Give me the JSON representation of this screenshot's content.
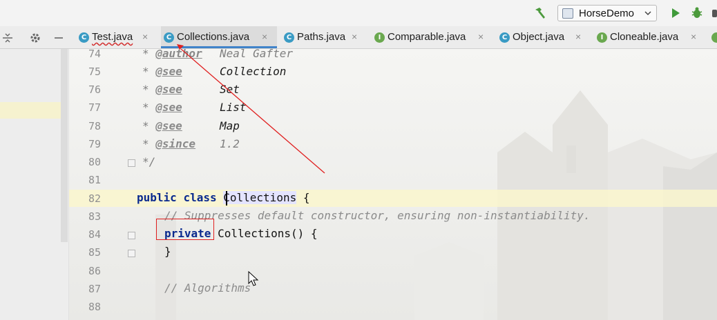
{
  "toolbar": {
    "run_config": "HorseDemo",
    "icons": [
      "hammer-icon",
      "run-icon",
      "debug-icon"
    ]
  },
  "tabs": [
    {
      "label": "Test.java",
      "type": "class",
      "letter": "C",
      "active": false,
      "has_error": true
    },
    {
      "label": "Collections.java",
      "type": "class",
      "letter": "C",
      "active": true,
      "has_error": false
    },
    {
      "label": "Paths.java",
      "type": "class",
      "letter": "C",
      "active": false,
      "has_error": false
    },
    {
      "label": "Comparable.java",
      "type": "interface",
      "letter": "I",
      "active": false,
      "has_error": false
    },
    {
      "label": "Object.java",
      "type": "class",
      "letter": "C",
      "active": false,
      "has_error": false
    },
    {
      "label": "Cloneable.java",
      "type": "interface",
      "letter": "I",
      "active": false,
      "has_error": false
    }
  ],
  "tab_close": "×",
  "editor": {
    "lines": [
      {
        "n": "74",
        "star": "* ",
        "tag": "@author",
        "val": "Neal Gafter"
      },
      {
        "n": "75",
        "star": "* ",
        "tag": "@see",
        "val": "Collection"
      },
      {
        "n": "76",
        "star": "* ",
        "tag": "@see",
        "val": "Set"
      },
      {
        "n": "77",
        "star": "* ",
        "tag": "@see",
        "val": "List"
      },
      {
        "n": "78",
        "star": "* ",
        "tag": "@see",
        "val": "Map"
      },
      {
        "n": "79",
        "star": "* ",
        "tag": "@since",
        "val": "1.2"
      },
      {
        "n": "80",
        "text": "*/"
      },
      {
        "n": "81"
      },
      {
        "n": "82",
        "kw1": "public",
        "kw2": "class",
        "cls": "Collections",
        "rest": " {"
      },
      {
        "n": "83",
        "comment": "// Suppresses default constructor, ensuring non-instantiability."
      },
      {
        "n": "84",
        "kw": "private",
        "rest": " Collections() {"
      },
      {
        "n": "85",
        "text": "}"
      },
      {
        "n": "86"
      },
      {
        "n": "87",
        "comment": "// Algorithms"
      },
      {
        "n": "88"
      }
    ]
  },
  "colors": {
    "keyword": "#0a2a8e",
    "active_tab_underline": "#4083c9",
    "annotation_red": "#e02020",
    "current_line": "#faf6ce"
  }
}
